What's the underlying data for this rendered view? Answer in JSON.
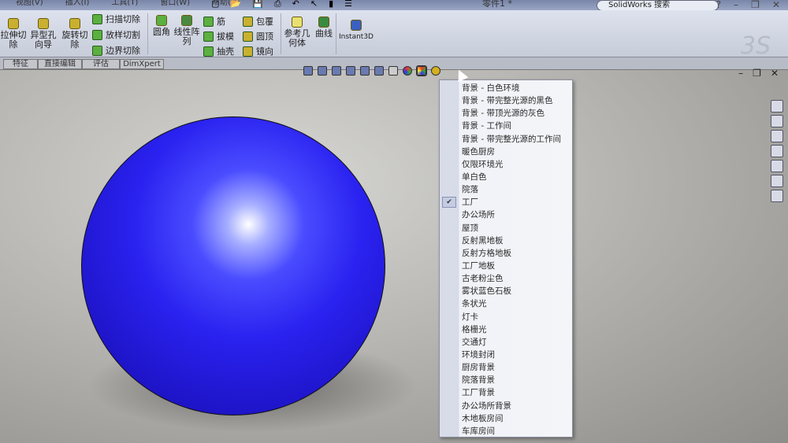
{
  "menubar": {
    "items": [
      "视图(V)",
      "插入(I)",
      "工具(T)",
      "窗口(W)",
      "帮助(H)"
    ]
  },
  "title": "零件1 *",
  "search": {
    "placeholder": "SolidWorks 搜索"
  },
  "window_buttons": [
    "?",
    "–",
    "❐",
    "✕"
  ],
  "ribbon": {
    "large": [
      "拉伸切除",
      "异型孔向导",
      "旋转切除",
      "圆角",
      "线性阵列",
      "参考几何体",
      "曲线",
      "Instant3D"
    ],
    "small1": [
      "扫描切除",
      "放样切割",
      "边界切除"
    ],
    "small2": [
      "筋",
      "拔模",
      "抽壳"
    ],
    "small3": [
      "包覆",
      "圆顶",
      "镜向"
    ]
  },
  "tabs": [
    "特征",
    "直接编辑",
    "评估",
    "DimXpert"
  ],
  "logo": "3DS",
  "scene_menu": {
    "items": [
      "背景 - 白色环境",
      "背景 - 带完整光源的黑色",
      "背景 - 带顶光源的灰色",
      "背景 - 工作间",
      "背景 - 带完整光源的工作间",
      "暖色厨房",
      "仅限环境光",
      "单白色",
      "院落",
      "工厂",
      "办公场所",
      "屋顶",
      "反射黑地板",
      "反射方格地板",
      "工厂地板",
      "古老粉尘色",
      "雾状蓝色石板",
      "条状光",
      "灯卡",
      "格栅光",
      "交通灯",
      "环境封闭",
      "厨房背景",
      "院落背景",
      "工厂背景",
      "办公场所背景",
      "木地板房间",
      "车库房间"
    ],
    "checked": "工厂",
    "check_mark": "✔"
  },
  "colors": {
    "sphere": "#2a22f0",
    "menu_bg": "#f4f5f9"
  }
}
